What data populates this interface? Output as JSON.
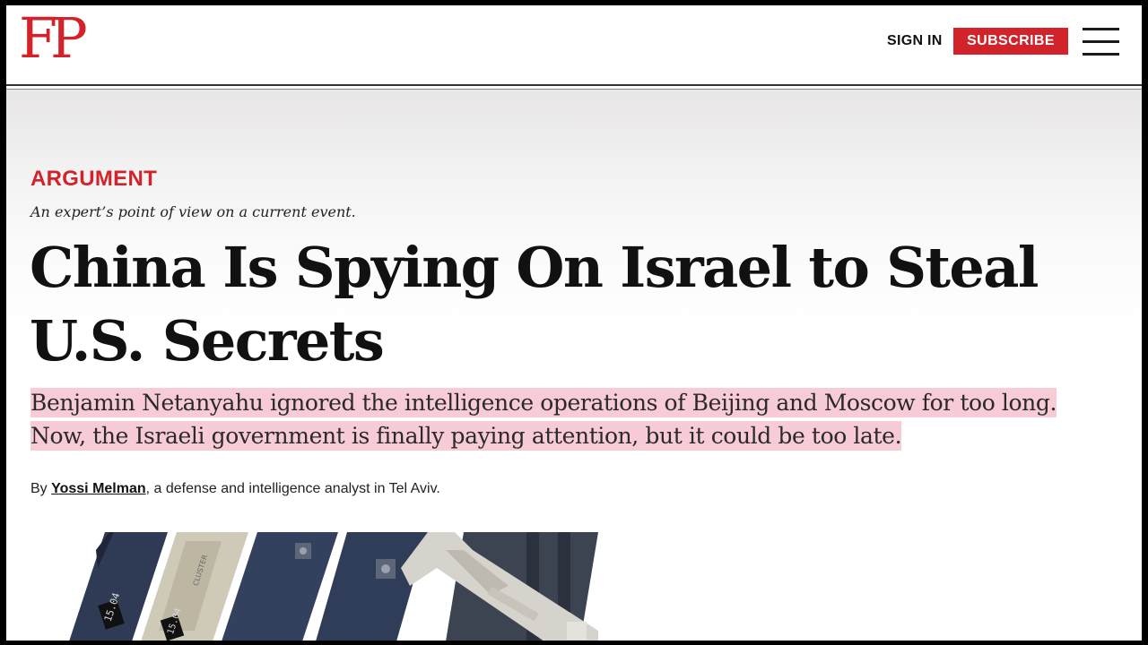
{
  "header": {
    "logo": "FP",
    "sign_in": "SIGN IN",
    "subscribe": "SUBSCRIBE",
    "menu_icon": "hamburger-menu-icon"
  },
  "article": {
    "kicker": "ARGUMENT",
    "kicker_description": "An expert’s point of view on a current event.",
    "headline": "China Is Spying On Israel to Steal U.S. Secrets",
    "dek_line1": "Benjamin Netanyahu ignored the intelligence operations of Beijing and Moscow for too long.",
    "dek_line2": "Now, the Israeli government is finally paying attention, but it could be too late.",
    "byline_prefix": "By ",
    "author": "Yossi Melman",
    "byline_suffix": ", a defense and intelligence analyst in Tel Aviv.",
    "photo_labels": [
      "15.04",
      "15.04",
      "CLUSTER"
    ]
  },
  "colors": {
    "brand_red": "#d2232a",
    "highlight_pink": "#f8ccd6",
    "text_dark": "#111111"
  }
}
